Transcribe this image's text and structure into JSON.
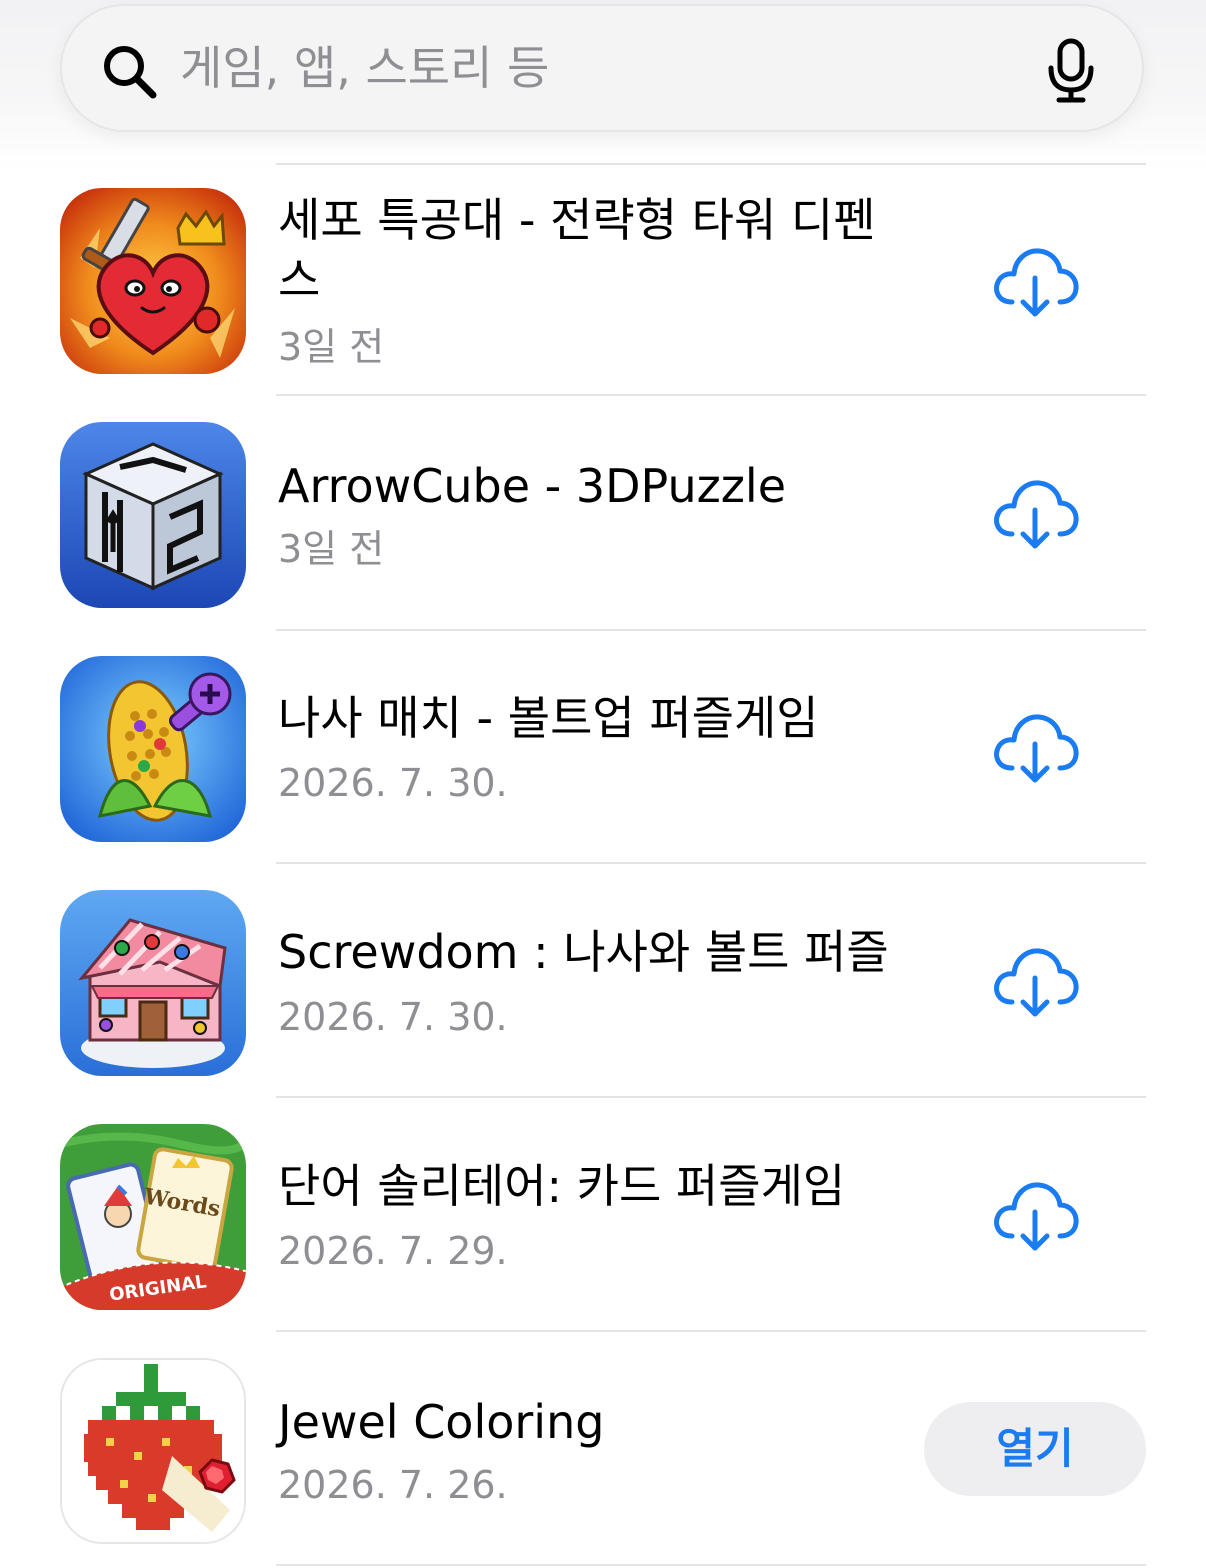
{
  "search": {
    "placeholder": "게임, 앱, 스토리 등"
  },
  "colors": {
    "accent": "#1a7cf0",
    "secondary_text": "#8e8e93",
    "divider": "#e3e3e6"
  },
  "apps": [
    {
      "title": "세포 특공대 - 전략형 타워 디펜스",
      "date": "3일 전",
      "action": "download",
      "icon": "heart-knight-icon"
    },
    {
      "title": "ArrowCube - 3DPuzzle",
      "date": "3일 전",
      "action": "download",
      "icon": "arrow-cube-icon"
    },
    {
      "title": "나사 매치 - 볼트업 퍼즐게임",
      "date": "2026. 7. 30.",
      "action": "download",
      "icon": "screw-corn-icon"
    },
    {
      "title": "Screwdom : 나사와 볼트 퍼즐",
      "date": "2026. 7. 30.",
      "action": "download",
      "icon": "screw-house-icon"
    },
    {
      "title": "단어 솔리테어: 카드 퍼즐게임",
      "date": "2026. 7. 29.",
      "action": "download",
      "icon": "word-cards-icon",
      "icon_text": {
        "card_word": "Words",
        "banner": "ORIGINAL"
      }
    },
    {
      "title": "Jewel Coloring",
      "date": "2026. 7. 26.",
      "action": "open",
      "action_label": "열기",
      "icon": "pixel-strawberry-icon"
    }
  ]
}
